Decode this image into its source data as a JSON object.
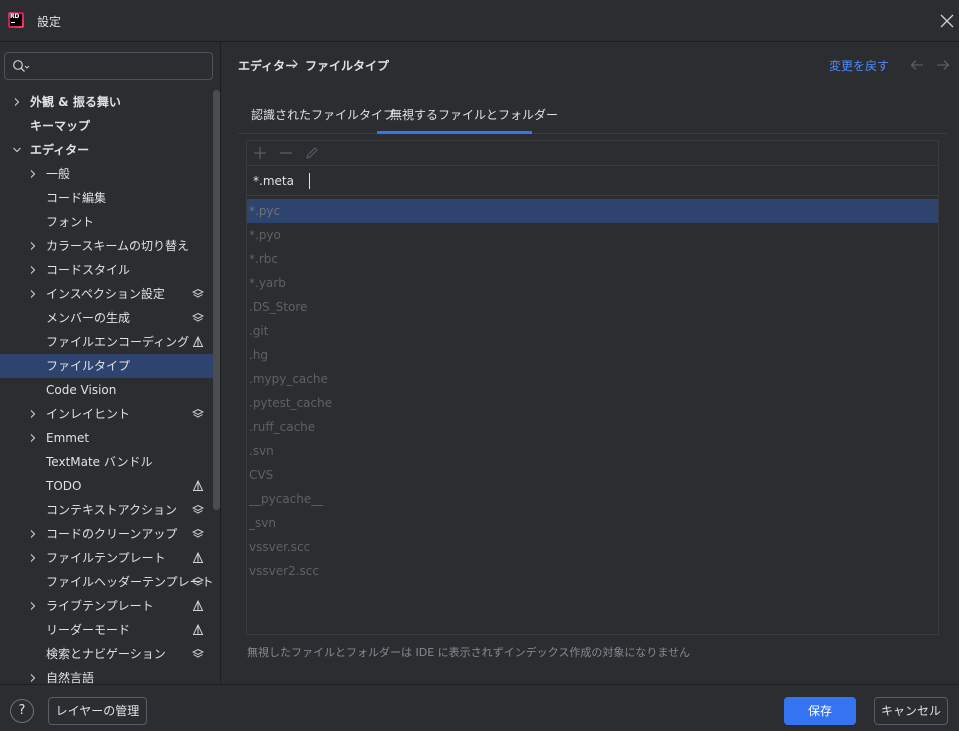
{
  "window": {
    "logo_text": "RD",
    "title": "設定"
  },
  "sidebar": {
    "search_placeholder": "",
    "items": [
      {
        "label": "外観 & 振る舞い",
        "arrow": "right",
        "bold": true,
        "level": 0,
        "badge": ""
      },
      {
        "label": "キーマップ",
        "arrow": "",
        "bold": true,
        "level": 0,
        "badge": ""
      },
      {
        "label": "エディター",
        "arrow": "down",
        "bold": true,
        "level": 0,
        "badge": ""
      },
      {
        "label": "一般",
        "arrow": "right",
        "bold": false,
        "level": 1,
        "badge": ""
      },
      {
        "label": "コード編集",
        "arrow": "",
        "bold": false,
        "level": 1,
        "badge": ""
      },
      {
        "label": "フォント",
        "arrow": "",
        "bold": false,
        "level": 1,
        "badge": ""
      },
      {
        "label": "カラースキームの切り替え",
        "arrow": "right",
        "bold": false,
        "level": 1,
        "badge": ""
      },
      {
        "label": "コードスタイル",
        "arrow": "right",
        "bold": false,
        "level": 1,
        "badge": ""
      },
      {
        "label": "インスペクション設定",
        "arrow": "right",
        "bold": false,
        "level": 1,
        "badge": "layers-icon"
      },
      {
        "label": "メンバーの生成",
        "arrow": "",
        "bold": false,
        "level": 1,
        "badge": "layers-icon"
      },
      {
        "label": "ファイルエンコーディング",
        "arrow": "",
        "bold": false,
        "level": 1,
        "badge": "project-icon"
      },
      {
        "label": "ファイルタイプ",
        "arrow": "",
        "bold": false,
        "level": 1,
        "badge": "",
        "selected": true
      },
      {
        "label": "Code Vision",
        "arrow": "",
        "bold": false,
        "level": 1,
        "badge": ""
      },
      {
        "label": "インレイヒント",
        "arrow": "right",
        "bold": false,
        "level": 1,
        "badge": "layers-icon"
      },
      {
        "label": "Emmet",
        "arrow": "right",
        "bold": false,
        "level": 1,
        "badge": ""
      },
      {
        "label": "TextMate バンドル",
        "arrow": "",
        "bold": false,
        "level": 1,
        "badge": ""
      },
      {
        "label": "TODO",
        "arrow": "",
        "bold": false,
        "level": 1,
        "badge": "project-icon"
      },
      {
        "label": "コンテキストアクション",
        "arrow": "",
        "bold": false,
        "level": 1,
        "badge": "layers-icon"
      },
      {
        "label": "コードのクリーンアップ",
        "arrow": "right",
        "bold": false,
        "level": 1,
        "badge": "layers-icon"
      },
      {
        "label": "ファイルテンプレート",
        "arrow": "right",
        "bold": false,
        "level": 1,
        "badge": "project-icon"
      },
      {
        "label": "ファイルヘッダーテンプレート",
        "arrow": "",
        "bold": false,
        "level": 1,
        "badge": "layers-icon"
      },
      {
        "label": "ライブテンプレート",
        "arrow": "right",
        "bold": false,
        "level": 1,
        "badge": "project-icon"
      },
      {
        "label": "リーダーモード",
        "arrow": "",
        "bold": false,
        "level": 1,
        "badge": "project-icon"
      },
      {
        "label": "検索とナビゲーション",
        "arrow": "",
        "bold": false,
        "level": 1,
        "badge": "layers-icon"
      },
      {
        "label": "自然言語",
        "arrow": "right",
        "bold": false,
        "level": 1,
        "badge": ""
      }
    ]
  },
  "header": {
    "breadcrumb_1": "エディター",
    "breadcrumb_2": "ファイルタイプ",
    "reset_label": "変更を戻す"
  },
  "tabs": [
    {
      "label": "認識されたファイルタイプ",
      "active": false
    },
    {
      "label": "無視するファイルとフォルダー",
      "active": true
    }
  ],
  "editor": {
    "input_value": "*.meta"
  },
  "ignored_list": [
    "*.pyc",
    "*.pyo",
    "*.rbc",
    "*.yarb",
    ".DS_Store",
    ".git",
    ".hg",
    ".mypy_cache",
    ".pytest_cache",
    ".ruff_cache",
    ".svn",
    "CVS",
    "__pycache__",
    "_svn",
    "vssver.scc",
    "vssver2.scc"
  ],
  "hint": "無視したファイルとフォルダーは IDE に表示されずインデックス作成の対象になりません",
  "footer": {
    "help_label": "?",
    "layers_button": "レイヤーの管理",
    "save_button": "保存",
    "cancel_button": "キャンセル"
  },
  "colors": {
    "background": "#2b2d30",
    "selection": "#2e436e",
    "accent": "#3574f0",
    "link": "#548af7"
  }
}
